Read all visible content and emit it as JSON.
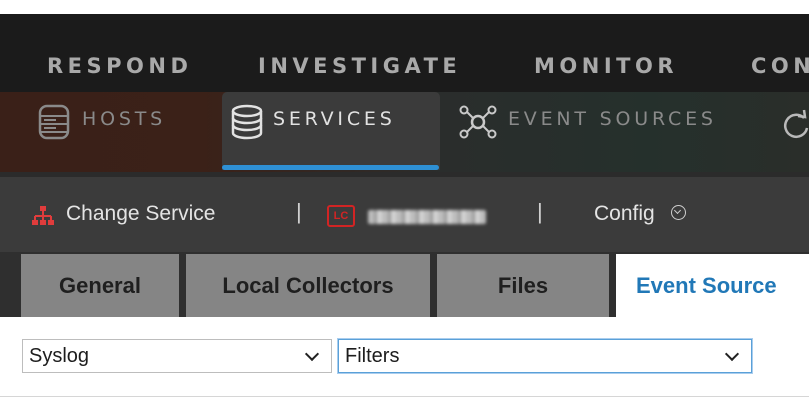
{
  "main_nav": {
    "items": [
      "RESPOND",
      "INVESTIGATE",
      "MONITOR",
      "CON"
    ]
  },
  "sub_nav": {
    "tabs": [
      {
        "label": "HOSTS",
        "icon": "server-rack-icon",
        "active": false
      },
      {
        "label": "SERVICES",
        "icon": "database-icon",
        "active": true
      },
      {
        "label": "EVENT SOURCES",
        "icon": "network-hub-icon",
        "active": false
      }
    ],
    "accent": "#2e90d5"
  },
  "service_bar": {
    "change_service_label": "Change Service",
    "separator": "|",
    "service_badge": "LC",
    "config_label": "Config"
  },
  "tabs": [
    "General",
    "Local Collectors",
    "Files",
    "Event Source"
  ],
  "filters": {
    "type_select_value": "Syslog",
    "filters_select_value": "Filters"
  },
  "colors": {
    "active_tab_text": "#2178b7",
    "badge_red": "#d22424"
  }
}
